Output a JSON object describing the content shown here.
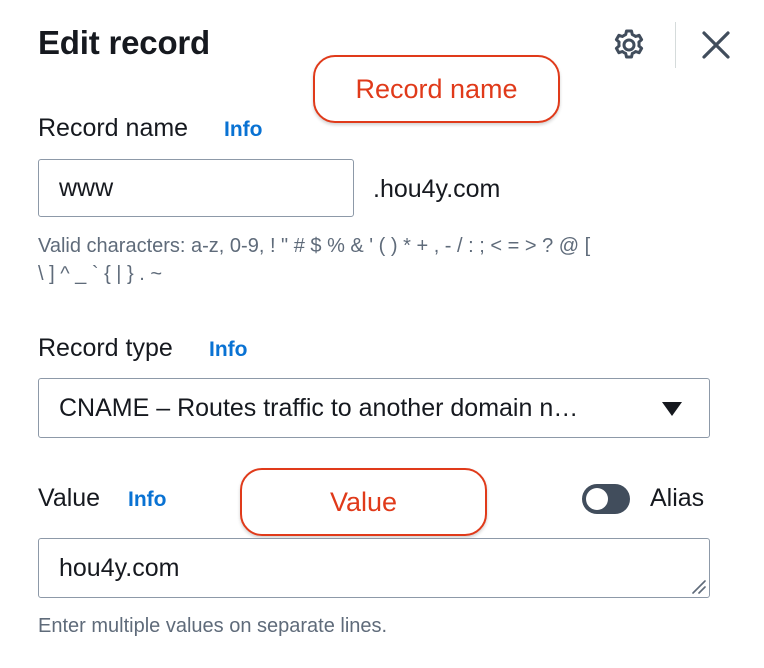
{
  "header": {
    "title": "Edit record",
    "settings_icon": "gear-icon",
    "close_icon": "close-icon"
  },
  "callouts": {
    "record_name": "Record name",
    "value": "Value"
  },
  "record_name": {
    "label": "Record name",
    "info": "Info",
    "value": "www",
    "domain_suffix": ".hou4y.com",
    "hint_line1": "Valid characters: a-z, 0-9, ! \" # $ % & ' ( ) * + , - / : ; < = > ? @ [",
    "hint_line2": "\\ ] ^ _ ` { | } . ~"
  },
  "record_type": {
    "label": "Record type",
    "info": "Info",
    "selected": "CNAME – Routes traffic to another domain n…"
  },
  "value_field": {
    "label": "Value",
    "info": "Info",
    "alias_label": "Alias",
    "alias_enabled": false,
    "value": "hou4y.com",
    "hint": "Enter multiple values on separate lines."
  },
  "colors": {
    "callout": "#e03a1a",
    "link": "#0972d3",
    "toggle_off": "#414d5c"
  }
}
